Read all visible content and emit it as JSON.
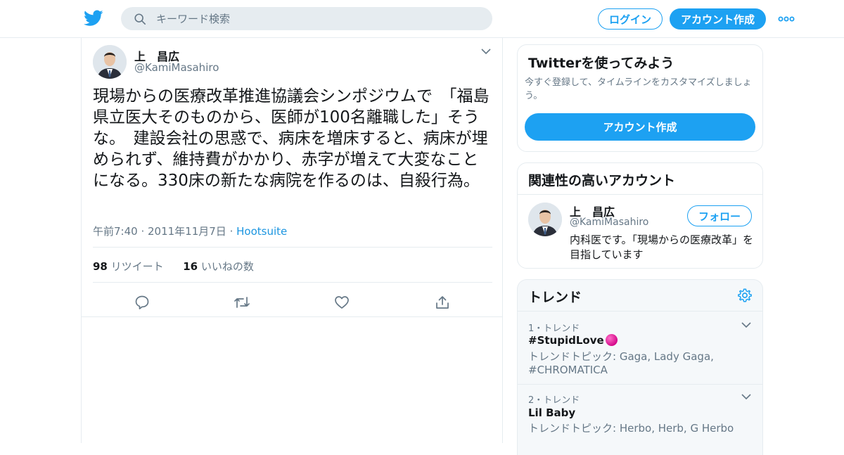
{
  "header": {
    "search_placeholder": "キーワード検索",
    "login_label": "ログイン",
    "signup_label": "アカウント作成"
  },
  "tweet": {
    "author_name": "上　昌広",
    "author_handle": "@KamiMasahiro",
    "text": "現場からの医療改革推進協議会シンポジウムで　「福島県立医大そのものから、医師が100名離職した」そうな。　建設会社の思惑で、病床を増床すると、病床が埋められず、維持費がかかり、赤字が増えて大変なことになる。330床の新たな病院を作るのは、自殺行為。",
    "timestamp": "午前7:40 · 2011年11月7日",
    "source_sep": " · ",
    "source": "Hootsuite",
    "retweet_count": "98",
    "retweet_label": " リツイート",
    "like_count": "16",
    "like_label": " いいねの数"
  },
  "try_twitter": {
    "title": "Twitterを使ってみよう",
    "description": "今すぐ登録して、タイムラインをカスタマイズしましょう。",
    "button_label": "アカウント作成"
  },
  "related": {
    "title": "関連性の高いアカウント",
    "name": "上　昌広",
    "handle": "@KamiMasahiro",
    "follow_label": "フォロー",
    "bio": "内科医です。「現場からの医療改革」を目指しています"
  },
  "trends": {
    "title": "トレンド",
    "items": [
      {
        "meta": "1・トレンド",
        "name": "#StupidLove",
        "topic": "トレンドトピック: Gaga, Lady Gaga, #CHROMATICA"
      },
      {
        "meta": "2・トレンド",
        "name": "Lil Baby",
        "topic": "トレンドトピック: Herbo, Herb, G Herbo"
      }
    ]
  },
  "colors": {
    "accent": "#1da1f2",
    "text": "#14171a",
    "secondary": "#657786",
    "border": "#e6ecf0"
  },
  "icons": [
    "twitter-bird-icon",
    "search-icon",
    "more-icon",
    "chevron-down-icon",
    "reply-icon",
    "retweet-icon",
    "like-icon",
    "share-icon",
    "gear-icon"
  ]
}
